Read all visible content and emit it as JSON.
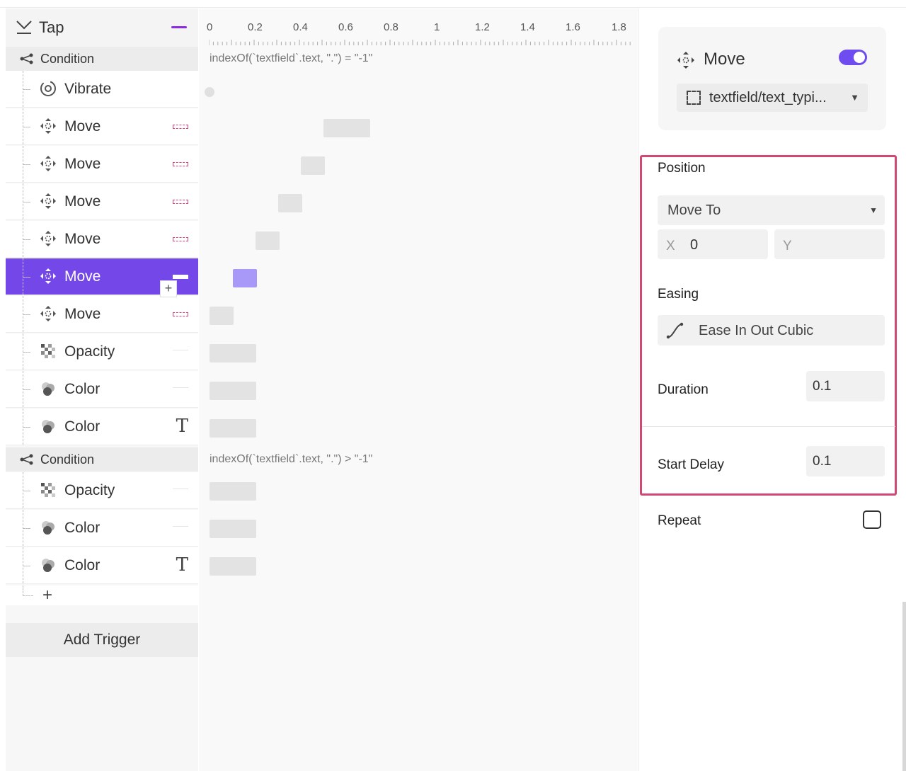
{
  "colors": {
    "accent": "#7448e8",
    "highlight_box": "#d14873",
    "selected_block": "#a898f8"
  },
  "trigger": {
    "label": "Tap",
    "icon": "tap-gesture-icon"
  },
  "conditions": [
    {
      "label": "Condition",
      "expression": "indexOf(`textfield`.text, \".\") = \"-1\""
    },
    {
      "label": "Condition",
      "expression": "indexOf(`textfield`.text, \".\") > \"-1\""
    }
  ],
  "steps": [
    {
      "label": "Vibrate",
      "icon": "vibrate-icon"
    },
    {
      "label": "Move",
      "icon": "move-icon"
    },
    {
      "label": "Move",
      "icon": "move-icon"
    },
    {
      "label": "Move",
      "icon": "move-icon"
    },
    {
      "label": "Move",
      "icon": "move-icon"
    },
    {
      "label": "Move",
      "icon": "move-icon",
      "selected": true
    },
    {
      "label": "Move",
      "icon": "move-icon"
    },
    {
      "label": "Opacity",
      "icon": "opacity-icon"
    },
    {
      "label": "Color",
      "icon": "color-icon"
    },
    {
      "label": "Color",
      "icon": "color-icon",
      "mark": "T"
    },
    {
      "label": "Opacity",
      "icon": "opacity-icon"
    },
    {
      "label": "Color",
      "icon": "color-icon"
    },
    {
      "label": "Color",
      "icon": "color-icon",
      "mark": "T"
    }
  ],
  "add_step": "+",
  "insert_plus": "+",
  "add_trigger": "Add Trigger",
  "ruler": [
    "0",
    "0.2",
    "0.4",
    "0.6",
    "0.8",
    "1",
    "1.2",
    "1.4",
    "1.6",
    "1.8"
  ],
  "panel": {
    "title": "Move",
    "enabled": true,
    "target": "textfield/text_typi...",
    "position_label": "Position",
    "position_mode": "Move To",
    "x_label": "X",
    "x_value": "0",
    "y_label": "Y",
    "y_value": "",
    "easing_label": "Easing",
    "easing_value": "Ease In Out Cubic",
    "duration_label": "Duration",
    "duration_value": "0.1",
    "start_delay_label": "Start Delay",
    "start_delay_value": "0.1",
    "repeat_label": "Repeat",
    "repeat_checked": false
  }
}
